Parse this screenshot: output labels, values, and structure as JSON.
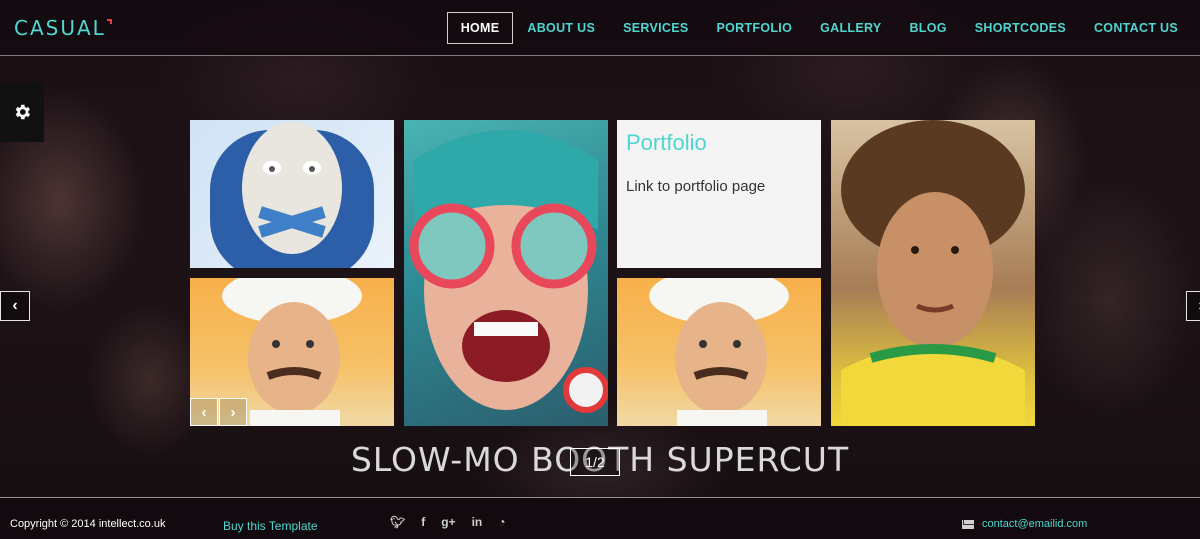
{
  "header": {
    "logo": "CASUAL",
    "nav": [
      "HOME",
      "ABOUT US",
      "SERVICES",
      "PORTFOLIO",
      "GALLERY",
      "BLOG",
      "SHORTCODES",
      "CONTACT US"
    ],
    "active": "HOME"
  },
  "settings": {
    "icon": "gear-icon"
  },
  "slider": {
    "prev_icon": "chevron-left-icon",
    "next_icon": "chevron-right-icon",
    "caption": "SLOW-MO BOOTH SUPERCUT",
    "pager": "1/2"
  },
  "grid": {
    "portfolio_title": "Portfolio",
    "portfolio_text": "Link to portfolio page",
    "tile_prev": "‹",
    "tile_next": "›"
  },
  "footer": {
    "copyright": "Copyright  © 2014 intellect.co.uk",
    "buy": "Buy this Template",
    "social": [
      "twitter-icon",
      "facebook-icon",
      "google-plus-icon",
      "linkedin-icon",
      "rss-icon"
    ],
    "contact": "contact@emailid.com"
  },
  "colors": {
    "accent": "#4fd6d0",
    "logo_mark": "#e0404a",
    "footer_bg": "#120a0e"
  }
}
